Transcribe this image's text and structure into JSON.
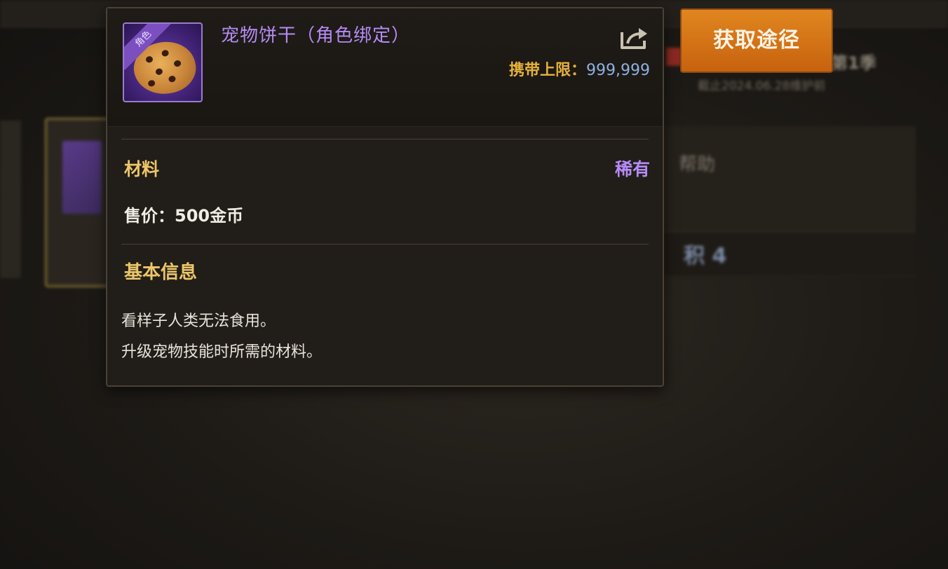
{
  "background": {
    "season_text": "第1季",
    "date_text": "截止2024.06.28维护前",
    "help_text": "帮助",
    "count_text": "积 4"
  },
  "tooltip": {
    "item_name": "宠物饼干（角色绑定）",
    "badge_text": "角色",
    "carry_label": "携带上限：",
    "carry_value": "999,999",
    "category": "材料",
    "rarity": "稀有",
    "price": "售价：500金币",
    "basic_info_title": "基本信息",
    "description_lines": [
      "看样子人类无法食用。",
      "升级宠物技能时所需的材料。"
    ],
    "share_icon": "share-icon"
  },
  "actions": {
    "get_source_label": "获取途径"
  },
  "colors": {
    "rarity_purple": "#b58bf5",
    "gold_label": "#ecc66a",
    "button_orange": "#d9761a"
  }
}
